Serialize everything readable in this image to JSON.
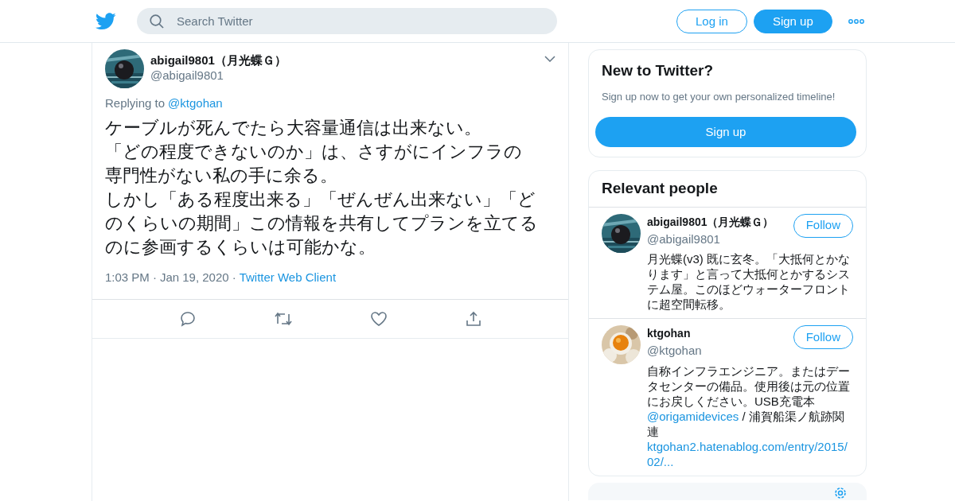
{
  "header": {
    "search": {
      "placeholder": "Search Twitter"
    },
    "buttons": [
      {
        "label": "Log in",
        "kind": "outline"
      },
      {
        "label": "Sign up",
        "kind": "solid"
      }
    ]
  },
  "tweet": {
    "name": "abigail9801（月光蝶Ｇ）",
    "handle": "@abigail9801",
    "replying_label": "Replying to",
    "replying_to": "@ktgohan",
    "text_lines": [
      "ケーブルが死んでたら大容量通信は出来ない。",
      "「どの程度できないのか」は、さすがにインフラの",
      "専門性がない私の手に余る。",
      "しかし「ある程度出来る」「ぜんぜん出来ない」「ど",
      "のくらいの期間」この情報を共有してプランを立てる",
      "のに参画するくらいは可能かな。"
    ],
    "time": "1:03 PM",
    "separator_1": "·",
    "date": "Jan 19, 2020",
    "separator_2": "·",
    "source": "Twitter Web Client"
  },
  "signup_card": {
    "title": "New to Twitter?",
    "subtitle": "Sign up now to get your own personalized timeline!",
    "button": "Sign up"
  },
  "relevant_people": {
    "title": "Relevant people",
    "people": [
      {
        "name": "abigail9801（月光蝶Ｇ）",
        "handle": "@abigail9801",
        "follow": "Follow",
        "bio": [
          {
            "kind": "text",
            "text": "月光蝶(v3) 既に玄冬。「大抵何とかなります」と言って大抵何とかするシステム屋。このほどウォーターフロントに超空間転移。"
          }
        ]
      },
      {
        "name": "ktgohan",
        "handle": "@ktgohan",
        "follow": "Follow",
        "bio": [
          {
            "kind": "text",
            "text": "自称インフラエンジニア。またはデータセンターの備品。使用後は元の位置にお戻しください。USB充電本 "
          },
          {
            "kind": "link",
            "text": "@origamidevices"
          },
          {
            "kind": "text",
            "text": " / 浦賀船渠ノ航跡関連 "
          },
          {
            "kind": "url",
            "text": "ktgohan2.hatenablog.com/entry/2015/02/..."
          }
        ]
      }
    ]
  }
}
